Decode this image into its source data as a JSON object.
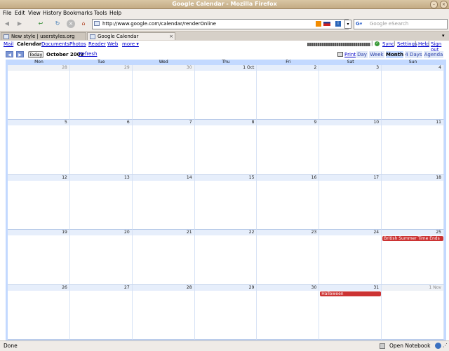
{
  "window": {
    "title": "Google Calendar - Mozilla Firefox"
  },
  "menubar": [
    "File",
    "Edit",
    "View",
    "History",
    "Bookmarks",
    "Tools",
    "Help"
  ],
  "navbar": {
    "url": "http://www.google.com/calendar/renderOnline",
    "search_placeholder": "Google eSearch"
  },
  "tabs": [
    {
      "label": "New style | userstyles.org",
      "active": false
    },
    {
      "label": "Google Calendar",
      "active": true
    }
  ],
  "google_bar": {
    "links": [
      "Mail",
      "Calendar",
      "Documents",
      "Photos",
      "Reader",
      "Web",
      "more ▾"
    ],
    "current": "Calendar",
    "right_links": [
      "Sync",
      "Settings",
      "Help",
      "Sign out"
    ]
  },
  "calendar": {
    "month_label": "October 2009",
    "today_label": "Today",
    "refresh_label": "Refresh",
    "print_label": "Print",
    "views": [
      "Day",
      "Week",
      "Month",
      "4 Days",
      "Agenda"
    ],
    "active_view": "Month",
    "weekdays": [
      "Mon",
      "Tue",
      "Wed",
      "Thu",
      "Fri",
      "Sat",
      "Sun"
    ],
    "weeks": [
      [
        "28",
        "29",
        "30",
        "1 Oct",
        "2",
        "3",
        "4"
      ],
      [
        "5",
        "6",
        "7",
        "8",
        "9",
        "10",
        "11"
      ],
      [
        "12",
        "13",
        "14",
        "15",
        "16",
        "17",
        "18"
      ],
      [
        "19",
        "20",
        "21",
        "22",
        "23",
        "24",
        "25"
      ],
      [
        "26",
        "27",
        "28",
        "29",
        "30",
        "31",
        "1 Nov"
      ]
    ],
    "events": [
      {
        "week": 3,
        "day": 6,
        "title": "British Summer Time Ends"
      },
      {
        "week": 4,
        "day": 5,
        "title": "Halloween"
      }
    ],
    "event_color": "#cc3333"
  },
  "statusbar": {
    "text": "Done",
    "notebook": "Open Notebook"
  }
}
